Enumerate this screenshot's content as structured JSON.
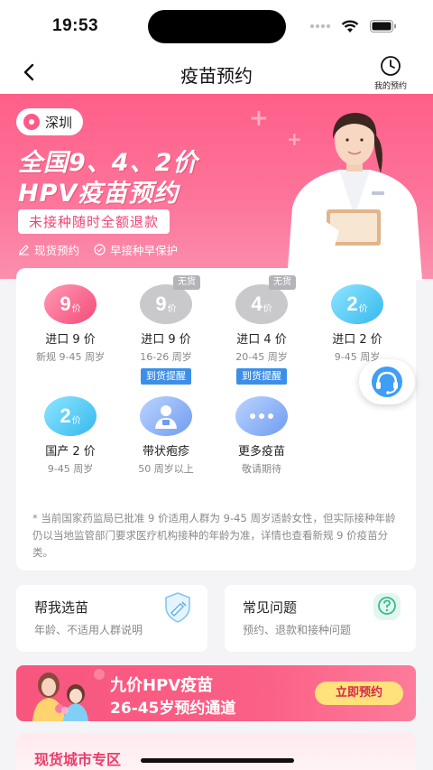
{
  "status_bar": {
    "time": "19:53"
  },
  "nav": {
    "title": "疫苗预约",
    "my_appointments": "我的预约"
  },
  "hero": {
    "city": "深圳",
    "headline_1": "全国9、4、2价",
    "headline_2": "HPV疫苗预约",
    "refund_badge": "未接种随时全额退款",
    "tags": [
      "现货预约",
      "早接种早保护"
    ],
    "accent_color": "#ff5f89"
  },
  "vaccines": [
    {
      "number": "9",
      "unit": "价",
      "name": "进口 9 价",
      "age": "新规 9-45 周岁",
      "color": "pink"
    },
    {
      "number": "9",
      "unit": "价",
      "name": "进口 9 价",
      "age": "16-26 周岁",
      "badge": "无货",
      "action": "到货提醒",
      "color": "gray"
    },
    {
      "number": "4",
      "unit": "价",
      "name": "进口 4 价",
      "age": "20-45 周岁",
      "badge": "无货",
      "action": "到货提醒",
      "color": "gray"
    },
    {
      "number": "2",
      "unit": "价",
      "name": "进口 2 价",
      "age": "9-45 周岁",
      "color": "blue"
    },
    {
      "number": "2",
      "unit": "价",
      "name": "国产 2 价",
      "age": "9-45 周岁",
      "color": "blue"
    },
    {
      "name": "带状疱疹",
      "age": "50 周岁以上",
      "icon": "person-icon",
      "color": "lavender"
    },
    {
      "name": "更多疫苗",
      "age": "敬请期待",
      "icon": "more-dots-icon",
      "color": "lavender"
    }
  ],
  "note": "* 当前国家药监局已批准 9 价适用人群为 9-45 周岁适龄女性，但实际接种年龄仍以当地监管部门要求医疗机构接种的年龄为准，详情也查看新规 9 价疫苗分类。",
  "help_cards": [
    {
      "title": "帮我选苗",
      "subtitle": "年龄、不适用人群说明",
      "icon": "vaccine-shield-icon"
    },
    {
      "title": "常见问题",
      "subtitle": "预约、退款和接种问题",
      "icon": "question-icon"
    }
  ],
  "promo": {
    "title": "九价HPV疫苗",
    "subtitle": "26-45岁预约通道",
    "button": "立即预约"
  },
  "city_section": {
    "title": "现货城市专区"
  }
}
